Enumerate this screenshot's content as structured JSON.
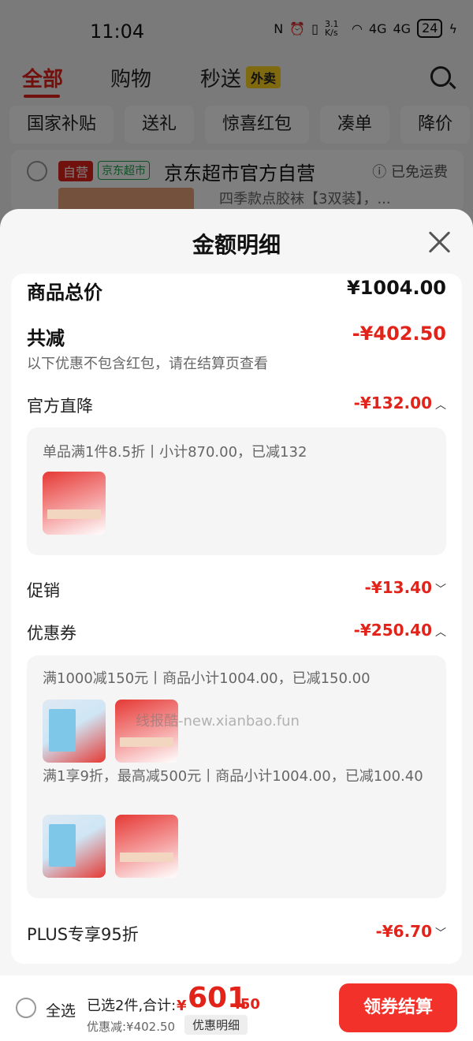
{
  "status": {
    "time": "11:04",
    "net_speed": "3.1 K/s",
    "net1": "4G",
    "net2": "4G",
    "battery": "24"
  },
  "nav": {
    "tabs": [
      "全部",
      "购物",
      "秒送"
    ],
    "waimai_badge": "外卖"
  },
  "chips": [
    "国家补贴",
    "送礼",
    "惊喜红包",
    "凑单",
    "降价"
  ],
  "shop": {
    "self_tag": "自营",
    "market_tag": "京东超市",
    "name": "京东超市官方自营",
    "freeship": "已免运费",
    "product_title": "四季款点胶袜【3双装】，..."
  },
  "sheet": {
    "title": "金额明细",
    "total_label": "商品总价",
    "total_value": "¥1004.00",
    "reduce_label": "共减",
    "reduce_value": "-¥402.50",
    "note": "以下优惠不包含红包，请在结算页查看",
    "official_label": "官方直降",
    "official_value": "-¥132.00",
    "official_detail": "单品满1件8.5折丨小计870.00，已减132",
    "promo_label": "促销",
    "promo_value": "-¥13.40",
    "coupon_label": "优惠券",
    "coupon_value": "-¥250.40",
    "coupon_detail1": "满1000减150元丨商品小计1004.00，已减150.00",
    "coupon_detail2": "满1享9折，最高减500元丨商品小计1004.00，已减100.40",
    "plus_label": "PLUS专享95折",
    "plus_value": "-¥6.70",
    "watermark": "线报酷-new.xianbao.fun"
  },
  "bottom": {
    "select_all": "全选",
    "selected_text": "已选2件,合计:",
    "currency": "¥",
    "price_int": "601",
    "price_dec": ".50",
    "discount_text": "优惠减:¥402.50",
    "detail_button": "优惠明细",
    "checkout_button": "领券结算"
  },
  "colors": {
    "accent_red": "#e2231a",
    "checkout_red": "#f2312a",
    "waimai_yellow": "#ffd51f",
    "market_green": "#1aa34a"
  }
}
